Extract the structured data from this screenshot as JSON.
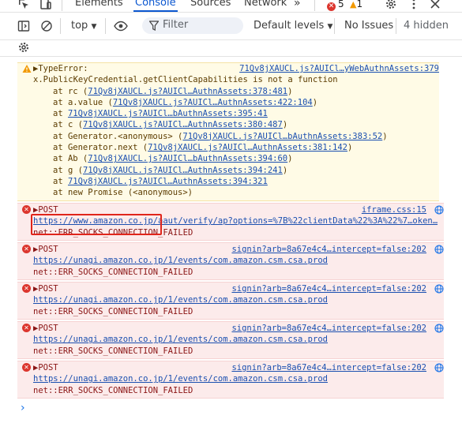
{
  "tabs": [
    "Elements",
    "Console",
    "Sources",
    "Network"
  ],
  "active_tab": "Console",
  "badges": {
    "errors": "5",
    "warnings": "1"
  },
  "toolbar": {
    "context": "top",
    "filter_placeholder": "Filter",
    "levels": "Default levels",
    "issues": "No Issues",
    "hidden": "4 hidden"
  },
  "warning": {
    "title": "TypeError:",
    "source": "71Qv8jXAUCL.js?AUICl…yWebAuthnAssets:379",
    "message": "x.PublicKeyCredential.getClientCapabilities is not a function",
    "stack": [
      {
        "prefix": "at rc (",
        "link": "71Qv8jXAUCL.js?AUICl…AuthnAssets:378:481",
        "suffix": ")"
      },
      {
        "prefix": "at a.value (",
        "link": "71Qv8jXAUCL.js?AUICl…AuthnAssets:422:104",
        "suffix": ")"
      },
      {
        "prefix": "at ",
        "link": "71Qv8jXAUCL.js?AUICl…bAuthnAssets:395:41",
        "suffix": ""
      },
      {
        "prefix": "at c (",
        "link": "71Qv8jXAUCL.js?AUICl…AuthnAssets:380:487",
        "suffix": ")"
      },
      {
        "prefix": "at Generator.<anonymous> (",
        "link": "71Qv8jXAUCL.js?AUICl…bAuthnAssets:383:52",
        "suffix": ")"
      },
      {
        "prefix": "at Generator.next (",
        "link": "71Qv8jXAUCL.js?AUICl…AuthnAssets:381:142",
        "suffix": ")"
      },
      {
        "prefix": "at Ab (",
        "link": "71Qv8jXAUCL.js?AUICl…bAuthnAssets:394:60",
        "suffix": ")"
      },
      {
        "prefix": "at g (",
        "link": "71Qv8jXAUCL.js?AUICl…AuthnAssets:394:241",
        "suffix": ")"
      },
      {
        "prefix": "at ",
        "link": "71Qv8jXAUCL.js?AUICl…AuthnAssets:394:321",
        "suffix": ""
      },
      {
        "prefix": "at new Promise (<anonymous>)",
        "link": "",
        "suffix": ""
      }
    ]
  },
  "errors": [
    {
      "method": "POST",
      "source": "iframe.css:15",
      "url": "https://www.amazon.co.jp/aaut/verify/ap?options=%7B%22clientData%22%3A%22%7…oken…",
      "status": "net::ERR_SOCKS_CONNECTION_FAILED"
    },
    {
      "method": "POST",
      "source": "signin?arb=8a67e4c4…intercept=false:202",
      "url": "https://unagi.amazon.co.jp/1/events/com.amazon.csm.csa.prod",
      "status": "net::ERR_SOCKS_CONNECTION_FAILED"
    },
    {
      "method": "POST",
      "source": "signin?arb=8a67e4c4…intercept=false:202",
      "url": "https://unagi.amazon.co.jp/1/events/com.amazon.csm.csa.prod",
      "status": "net::ERR_SOCKS_CONNECTION_FAILED"
    },
    {
      "method": "POST",
      "source": "signin?arb=8a67e4c4…intercept=false:202",
      "url": "https://unagi.amazon.co.jp/1/events/com.amazon.csm.csa.prod",
      "status": "net::ERR_SOCKS_CONNECTION_FAILED"
    },
    {
      "method": "POST",
      "source": "signin?arb=8a67e4c4…intercept=false:202",
      "url": "https://unagi.amazon.co.jp/1/events/com.amazon.csm.csa.prod",
      "status": "net::ERR_SOCKS_CONNECTION_FAILED"
    }
  ],
  "prompt": "›",
  "colors": {
    "accent": "#0b57d0",
    "error": "#dc362e",
    "warning": "#f29900",
    "highlight": "#e0251b"
  }
}
